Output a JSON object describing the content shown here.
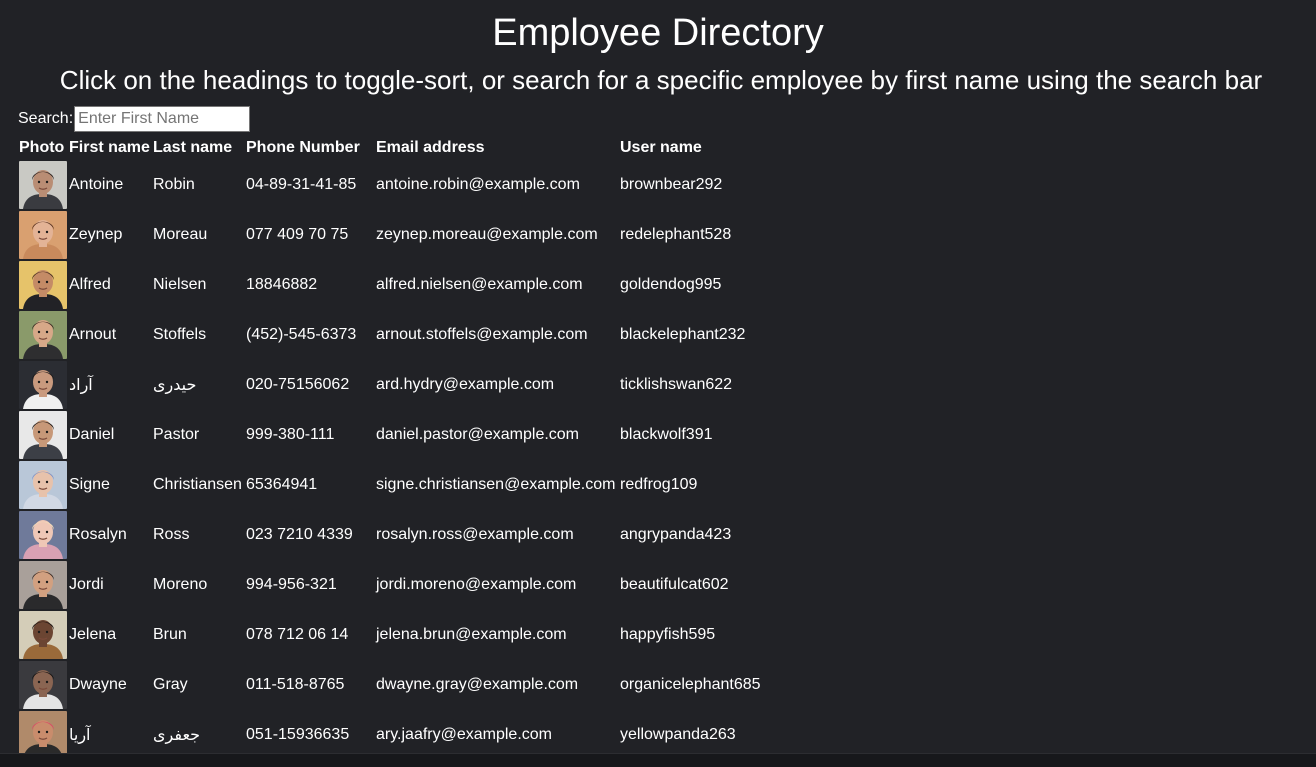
{
  "page": {
    "title": "Employee Directory",
    "subtitle": "Click on the headings to toggle-sort, or search for a specific employee by first name using the search bar"
  },
  "search": {
    "label": "Search:",
    "placeholder": "Enter First Name",
    "value": ""
  },
  "table": {
    "headers": [
      "Photo",
      "First name",
      "Last name",
      "Phone Number",
      "Email address",
      "User name"
    ],
    "rows": [
      {
        "first": "Antoine",
        "last": "Robin",
        "phone": "04-89-31-41-85",
        "email": "antoine.robin@example.com",
        "username": "brownbear292",
        "avatar": {
          "bg": "#c9c9c4",
          "skin": "#b98d74",
          "hair": "#2a2220",
          "shirt": "#3a3b40"
        }
      },
      {
        "first": "Zeynep",
        "last": "Moreau",
        "phone": "077 409 70 75",
        "email": "zeynep.moreau@example.com",
        "username": "redelephant528",
        "avatar": {
          "bg": "#d9a070",
          "skin": "#e3b396",
          "hair": "#5a3422",
          "shirt": "#c98a5c"
        }
      },
      {
        "first": "Alfred",
        "last": "Nielsen",
        "phone": "18846882",
        "email": "alfred.nielsen@example.com",
        "username": "goldendog995",
        "avatar": {
          "bg": "#e6c36a",
          "skin": "#c48b66",
          "hair": "#4a3020",
          "shirt": "#222226"
        }
      },
      {
        "first": "Arnout",
        "last": "Stoffels",
        "phone": "(452)-545-6373",
        "email": "arnout.stoffels@example.com",
        "username": "blackelephant232",
        "avatar": {
          "bg": "#8a9a6a",
          "skin": "#d7a888",
          "hair": "#3b2c22",
          "shirt": "#2e2e30"
        }
      },
      {
        "first": "آراد",
        "last": "حیدری",
        "phone": "020-75156062",
        "email": "ard.hydry@example.com",
        "username": "ticklishswan622",
        "avatar": {
          "bg": "#2b2d33",
          "skin": "#c99a7e",
          "hair": "#1c1a1a",
          "shirt": "#f0f0f0"
        }
      },
      {
        "first": "Daniel",
        "last": "Pastor",
        "phone": "999-380-111",
        "email": "daniel.pastor@example.com",
        "username": "blackwolf391",
        "avatar": {
          "bg": "#e8e8e8",
          "skin": "#c79878",
          "hair": "#1f1a18",
          "shirt": "#3c3f46"
        }
      },
      {
        "first": "Signe",
        "last": "Christiansen",
        "phone": "65364941",
        "email": "signe.christiansen@example.com",
        "username": "redfrog109",
        "avatar": {
          "bg": "#b9c7d8",
          "skin": "#e7c2ab",
          "hair": "#7f93c6",
          "shirt": "#d1d8e4"
        }
      },
      {
        "first": "Rosalyn",
        "last": "Ross",
        "phone": "023 7210 4339",
        "email": "rosalyn.ross@example.com",
        "username": "angrypanda423",
        "avatar": {
          "bg": "#6f7a9a",
          "skin": "#efc7b6",
          "hair": "#f1dcb8",
          "shirt": "#d9a1b3"
        }
      },
      {
        "first": "Jordi",
        "last": "Moreno",
        "phone": "994-956-321",
        "email": "jordi.moreno@example.com",
        "username": "beautifulcat602",
        "avatar": {
          "bg": "#a9a09a",
          "skin": "#d2a080",
          "hair": "#3a2c26",
          "shirt": "#2a2a2c"
        }
      },
      {
        "first": "Jelena",
        "last": "Brun",
        "phone": "078 712 06 14",
        "email": "jelena.brun@example.com",
        "username": "happyfish595",
        "avatar": {
          "bg": "#d4cdb8",
          "skin": "#6b4532",
          "hair": "#1b1412",
          "shirt": "#9a6a3a"
        }
      },
      {
        "first": "Dwayne",
        "last": "Gray",
        "phone": "011-518-8765",
        "email": "dwayne.gray@example.com",
        "username": "organicelephant685",
        "avatar": {
          "bg": "#3a3a3e",
          "skin": "#8a6552",
          "hair": "#151313",
          "shirt": "#e4e4e4"
        }
      },
      {
        "first": "آریا",
        "last": "جعفری",
        "phone": "051-15936635",
        "email": "ary.jaafry@example.com",
        "username": "yellowpanda263",
        "avatar": {
          "bg": "#b08a6a",
          "skin": "#c98c6c",
          "hair": "#d94a66",
          "shirt": "#2a2a2a"
        }
      }
    ]
  }
}
